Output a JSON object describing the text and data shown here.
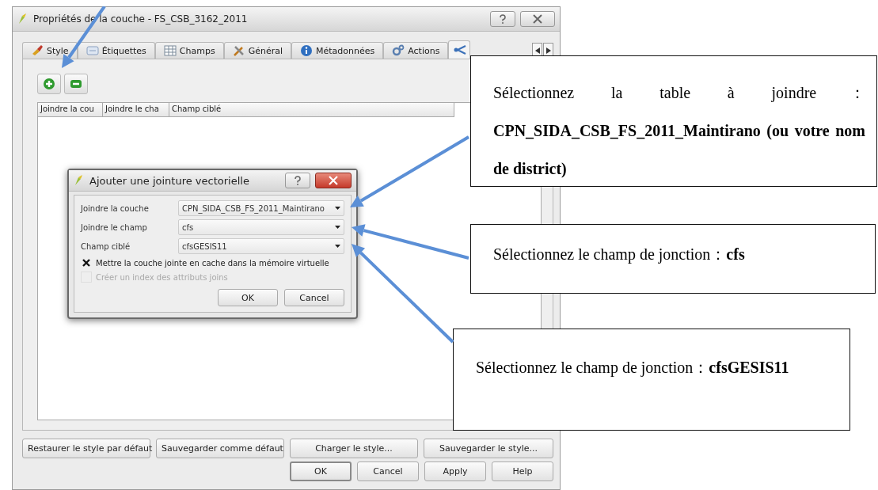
{
  "window": {
    "title": "Propriétés de la couche - FS_CSB_3162_2011",
    "tabs": [
      {
        "label": "Style",
        "kind": "brush",
        "selected": false
      },
      {
        "label": "Étiquettes",
        "kind": "label",
        "selected": false
      },
      {
        "label": "Champs",
        "kind": "table",
        "selected": false
      },
      {
        "label": "Général",
        "kind": "tools",
        "selected": false
      },
      {
        "label": "Métadonnées",
        "kind": "info",
        "selected": false
      },
      {
        "label": "Actions",
        "kind": "gear",
        "selected": false
      },
      {
        "kind": "join",
        "selected": true
      }
    ],
    "table": {
      "columns": [
        "Joindre la cou",
        "Joindre le cha",
        "Champ ciblé"
      ]
    },
    "style_buttons": [
      "Restaurer le style par défaut",
      "Sauvegarder comme défaut",
      "Charger le style...",
      "Sauvegarder le style..."
    ],
    "buttons": [
      {
        "label": "OK",
        "default": true
      },
      {
        "label": "Cancel",
        "default": false
      },
      {
        "label": "Apply",
        "default": false
      },
      {
        "label": "Help",
        "default": false
      }
    ]
  },
  "dialog": {
    "title": "Ajouter une jointure vectorielle",
    "fields": [
      {
        "label": "Joindre la couche",
        "value": "CPN_SIDA_CSB_FS_2011_Maintirano"
      },
      {
        "label": "Joindre le champ",
        "value": "cfs"
      },
      {
        "label": "Champ ciblé",
        "value": "cfsGESIS11"
      }
    ],
    "checkboxes": [
      {
        "label": "Mettre la couche jointe en cache dans la mémoire virtuelle",
        "checked": true,
        "disabled": false
      },
      {
        "label": "Créer un index des attributs joins",
        "checked": false,
        "disabled": true
      }
    ],
    "buttons": [
      "OK",
      "Cancel"
    ]
  },
  "annotations": [
    {
      "text": "Sélectionnez la table à joindre：**CPN_SIDA_CSB_FS_2011_Maintirano (ou votre nom de district)**"
    },
    {
      "text": "Sélectionnez le champ de jonction：**cfs**"
    },
    {
      "text": "Sélectionnez le champ de jonction：**cfsGESIS11**"
    }
  ]
}
